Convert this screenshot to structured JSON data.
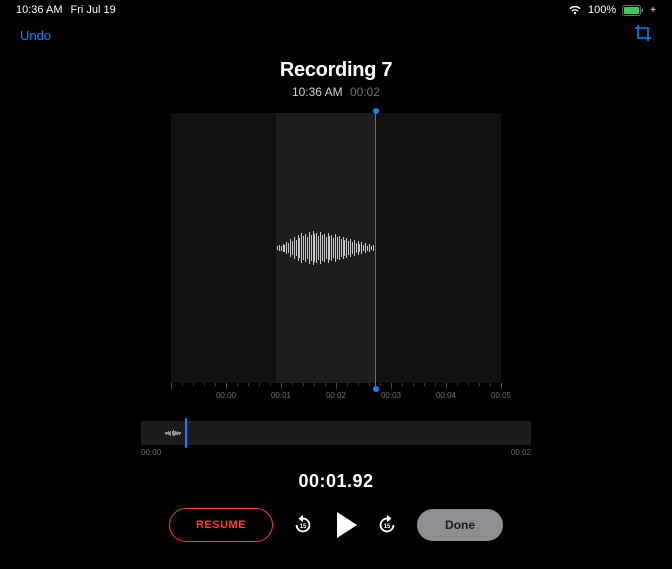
{
  "status": {
    "time": "10:36 AM",
    "date": "Fri Jul 19",
    "battery_pct": "100%",
    "battery_color": "#30d158"
  },
  "toolbar": {
    "undo_label": "Undo"
  },
  "recording": {
    "title": "Recording 7",
    "time_of_day": "10:36 AM",
    "duration": "00:02"
  },
  "ruler_labels": [
    "00:00",
    "00:01",
    "00:02",
    "00:03",
    "00:04",
    "00:05"
  ],
  "mini": {
    "start": "00:00",
    "end": "00:02"
  },
  "current_time": "00:01.92",
  "controls": {
    "resume_label": "RESUME",
    "done_label": "Done",
    "skip_amount": "15"
  },
  "accent_color": "#0a84ff"
}
